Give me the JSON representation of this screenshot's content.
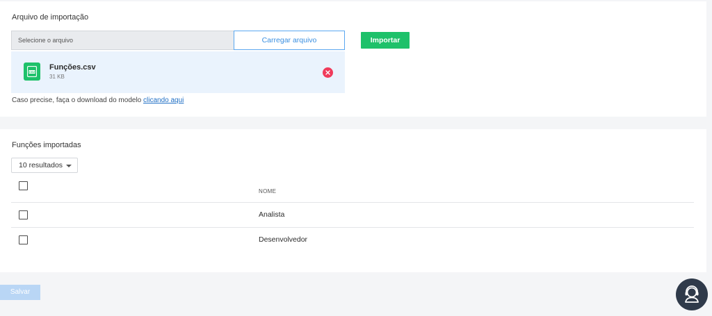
{
  "import_section": {
    "title": "Arquivo de importação",
    "file_input_placeholder": "Selecione o arquivo",
    "upload_label": "Carregar arquivo",
    "import_label": "Importar",
    "file": {
      "name": "Funções.csv",
      "size": "31 KB",
      "icon": "csv-file-icon"
    },
    "hint_text": "Caso precise, faça o download do modelo ",
    "hint_link": "clicando aqui"
  },
  "list_section": {
    "title": "Funções importadas",
    "results_selector": "10 resultados",
    "column_header": "NOME",
    "rows": [
      {
        "name": "Analista"
      },
      {
        "name": "Desenvolvedor"
      }
    ]
  },
  "footer": {
    "save_label": "Salvar"
  },
  "support": {
    "icon": "headset-support-icon"
  },
  "colors": {
    "primary_green": "#1ec16a",
    "accent_blue": "#3a8fe0",
    "danger_red": "#f03b5b",
    "disabled_blue": "#b9d6f5",
    "fab_dark": "#2f3a4a"
  }
}
